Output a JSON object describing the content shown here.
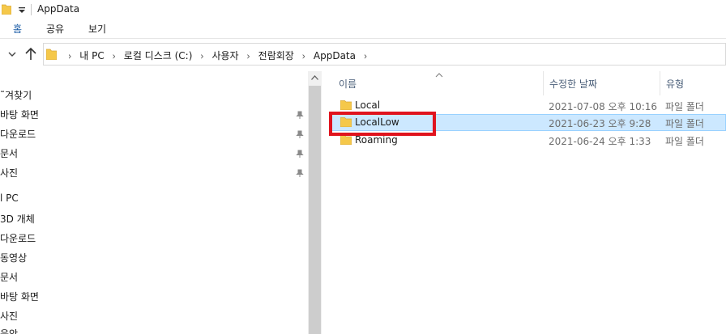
{
  "window": {
    "title": "AppData"
  },
  "ribbon": {
    "tabs": [
      "홈",
      "공유",
      "보기"
    ]
  },
  "address": {
    "crumbs": [
      "내 PC",
      "로컬 디스크 (C:)",
      "사용자",
      "전람회장",
      "AppData"
    ]
  },
  "nav": {
    "quick_access": "˜겨찾기",
    "items": [
      {
        "label": "바탕 화면",
        "pinned": true
      },
      {
        "label": "다운로드",
        "pinned": true
      },
      {
        "label": "문서",
        "pinned": true
      },
      {
        "label": "사진",
        "pinned": true
      }
    ],
    "this_pc": "l PC",
    "pc_items": [
      "3D 개체",
      "다운로드",
      "동영상",
      "문서",
      "바탕 화면",
      "사진",
      "음악"
    ]
  },
  "columns": {
    "name": "이름",
    "modified": "수정한 날짜",
    "type": "유형"
  },
  "files": [
    {
      "name": "Local",
      "modified": "2021-07-08 오후 10:16",
      "type": "파일 폴더",
      "selected": false
    },
    {
      "name": "LocalLow",
      "modified": "2021-06-23 오후 9:28",
      "type": "파일 폴더",
      "selected": true
    },
    {
      "name": "Roaming",
      "modified": "2021-06-24 오후 1:33",
      "type": "파일 폴더",
      "selected": false
    }
  ],
  "colors": {
    "folder": "#f5c84a",
    "selection": "#cce8ff",
    "highlight_box": "#e0141e"
  }
}
